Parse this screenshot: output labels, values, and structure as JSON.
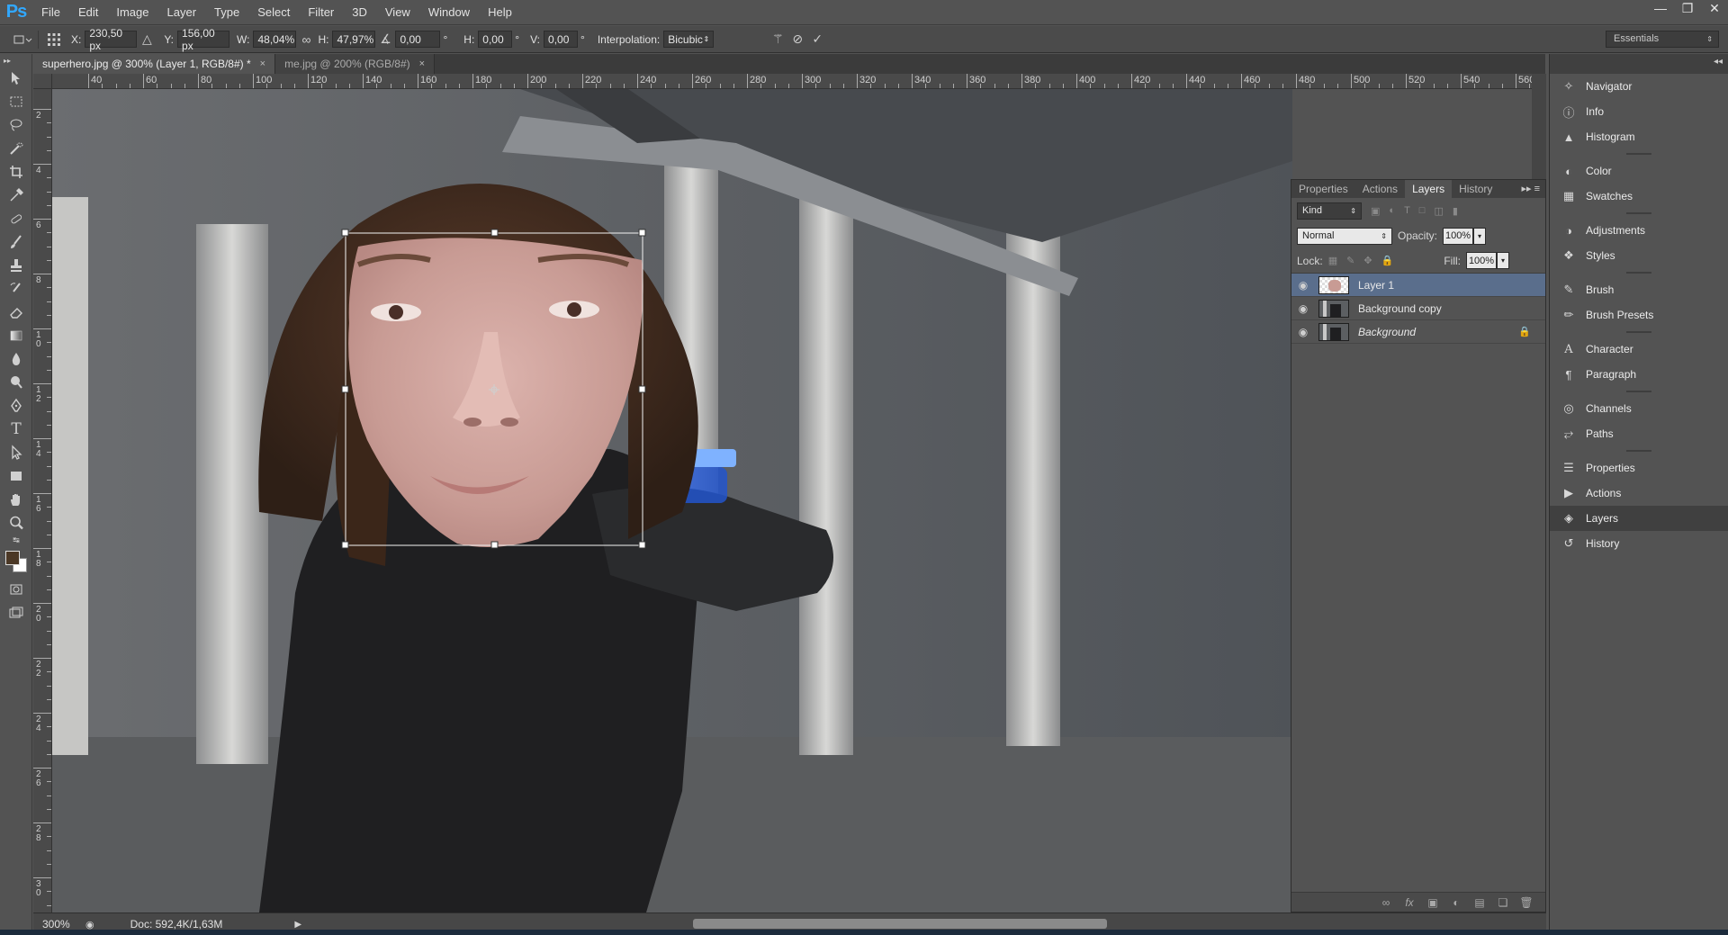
{
  "app": {
    "logo": "Ps"
  },
  "menu": [
    "File",
    "Edit",
    "Image",
    "Layer",
    "Type",
    "Select",
    "Filter",
    "3D",
    "View",
    "Window",
    "Help"
  ],
  "window_controls": [
    "minimize-icon",
    "restore-icon",
    "close-icon"
  ],
  "options": {
    "x_label": "X:",
    "x_value": "230,50 px",
    "y_label": "Y:",
    "y_value": "156,00 px",
    "w_label": "W:",
    "w_value": "48,04%",
    "h_label": "H:",
    "h_value": "47,97%",
    "angle_value": "0,00",
    "deg": "°",
    "hskew_label": "H:",
    "hskew_value": "0,00",
    "vskew_label": "V:",
    "vskew_value": "0,00",
    "interp_label": "Interpolation:",
    "interp_value": "Bicubic",
    "workspace": "Essentials"
  },
  "tabs": [
    {
      "label": "superhero.jpg @ 300% (Layer 1, RGB/8#) *",
      "close": "×",
      "active": true
    },
    {
      "label": "me.jpg @ 200% (RGB/8#)",
      "close": "×",
      "active": false
    }
  ],
  "ruler_h": [
    "40",
    "60",
    "80",
    "100",
    "120",
    "140",
    "160",
    "180",
    "200",
    "220",
    "240",
    "260",
    "280",
    "300",
    "320",
    "340",
    "360",
    "380",
    "400",
    "420",
    "440",
    "460",
    "480",
    "500",
    "520",
    "540",
    "560"
  ],
  "ruler_v": [
    "2",
    "4",
    "6",
    "8",
    "10",
    "12",
    "14",
    "16",
    "18",
    "20",
    "22",
    "24",
    "26",
    "28",
    "30"
  ],
  "status": {
    "zoom": "300%",
    "doc_info": "Doc: 592,4K/1,63M",
    "arrow": "▶"
  },
  "layers_panel": {
    "tabs": [
      "Properties",
      "Actions",
      "Layers",
      "History"
    ],
    "active_tab": "Layers",
    "menu_glyph": "▸▸ ≡",
    "kind_label": "Kind",
    "blend_mode": "Normal",
    "opacity_label": "Opacity:",
    "opacity_value": "100%",
    "lock_label": "Lock:",
    "fill_label": "Fill:",
    "fill_value": "100%",
    "layers": [
      {
        "name": "Layer 1",
        "selected": true,
        "italic": false,
        "locked": false
      },
      {
        "name": "Background copy",
        "selected": false,
        "italic": false,
        "locked": false
      },
      {
        "name": "Background",
        "selected": false,
        "italic": true,
        "locked": true
      }
    ]
  },
  "dock": {
    "header_glyph": "◂◂",
    "groups": [
      [
        {
          "label": "Navigator",
          "icon": "navigator-icon"
        },
        {
          "label": "Info",
          "icon": "info-icon"
        },
        {
          "label": "Histogram",
          "icon": "histogram-icon"
        }
      ],
      [
        {
          "label": "Color",
          "icon": "color-icon"
        },
        {
          "label": "Swatches",
          "icon": "swatches-icon"
        }
      ],
      [
        {
          "label": "Adjustments",
          "icon": "adjustments-icon"
        },
        {
          "label": "Styles",
          "icon": "styles-icon"
        }
      ],
      [
        {
          "label": "Brush",
          "icon": "brush-icon"
        },
        {
          "label": "Brush Presets",
          "icon": "brush-presets-icon"
        }
      ],
      [
        {
          "label": "Character",
          "icon": "character-icon"
        },
        {
          "label": "Paragraph",
          "icon": "paragraph-icon"
        }
      ],
      [
        {
          "label": "Channels",
          "icon": "channels-icon"
        },
        {
          "label": "Paths",
          "icon": "paths-icon"
        }
      ],
      [
        {
          "label": "Properties",
          "icon": "properties-icon"
        },
        {
          "label": "Actions",
          "icon": "actions-icon"
        },
        {
          "label": "Layers",
          "icon": "layers-icon",
          "active": true
        },
        {
          "label": "History",
          "icon": "history-icon"
        }
      ]
    ]
  },
  "colors": {
    "accent_selected": "#5a6e8c",
    "fg_swatch": "#4b3826",
    "bg_swatch": "#ffffff",
    "ps_blue": "#31a8ff"
  }
}
